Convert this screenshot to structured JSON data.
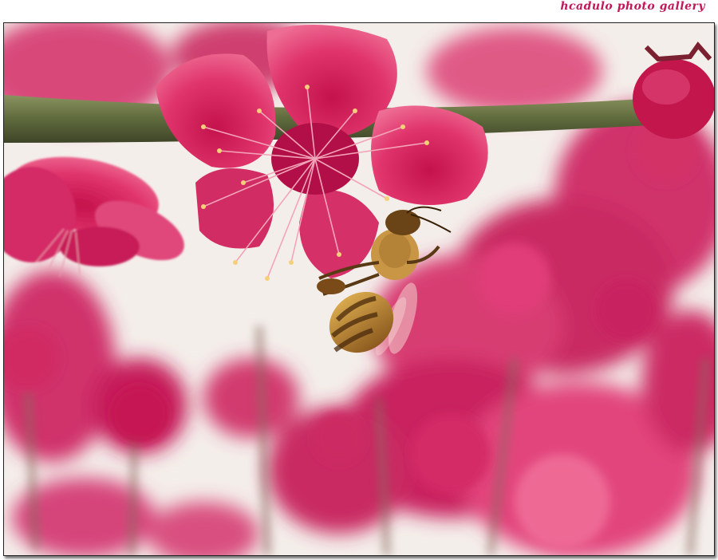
{
  "gallery": {
    "watermark_text": "hcadulo photo gallery"
  },
  "photo": {
    "subject": "honeybee on pink plum blossom",
    "colors": {
      "background": "#f4eeea",
      "blossom": "#e0346c",
      "blossom_dark": "#b8124a",
      "branch": "#5f6a3c",
      "bee": "#c08a3a"
    }
  }
}
